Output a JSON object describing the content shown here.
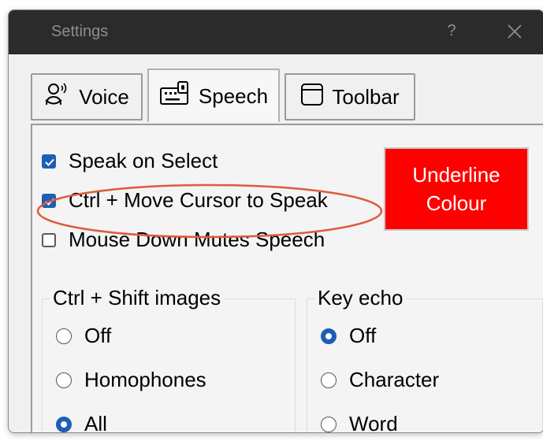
{
  "window": {
    "title": "Settings",
    "help_label": "?",
    "close_icon": "close-icon"
  },
  "tabs": [
    {
      "label": "Voice",
      "icon": "voice-speaker-icon",
      "active": false
    },
    {
      "label": "Speech",
      "icon": "keyboard-speech-icon",
      "active": true
    },
    {
      "label": "Toolbar",
      "icon": "toolbar-window-icon",
      "active": false
    }
  ],
  "speech_panel": {
    "checkboxes": [
      {
        "label": "Speak on Select",
        "checked": true
      },
      {
        "label": "Ctrl + Move Cursor to Speak",
        "checked": true,
        "highlighted": true
      },
      {
        "label": "Mouse Down Mutes Speech",
        "checked": false
      }
    ],
    "underline_button": {
      "line1": "Underline",
      "line2": "Colour",
      "color": "#ff0000"
    },
    "highlight_color": "#e05a3a",
    "ctrl_shift_images": {
      "title": "Ctrl + Shift images",
      "options": [
        {
          "label": "Off",
          "selected": false
        },
        {
          "label": "Homophones",
          "selected": false
        },
        {
          "label": "All",
          "selected": true
        }
      ]
    },
    "key_echo": {
      "title": "Key echo",
      "options": [
        {
          "label": "Off",
          "selected": true
        },
        {
          "label": "Character",
          "selected": false
        },
        {
          "label": "Word",
          "selected": false
        }
      ]
    }
  },
  "colors": {
    "accent": "#1e5fb3",
    "titlebar_bg": "#2b2b2b",
    "titlebar_text": "#8e8e8e"
  }
}
